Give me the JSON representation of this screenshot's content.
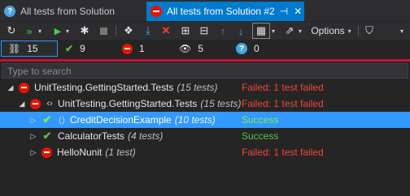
{
  "tabs": [
    {
      "label": "All tests from Solution",
      "icon": "question-icon",
      "active": false
    },
    {
      "label": "All tests from Solution #2",
      "icon": "failed-icon",
      "active": true,
      "pin_icon": "pin-icon",
      "close_icon": "close-icon"
    }
  ],
  "toolbar": {
    "options_label": "Options",
    "buttons": [
      "refresh-icon",
      "run-all-icon",
      "run-dropdown-icon",
      "run-icon",
      "run-dropdown-icon",
      "debug-icon",
      "stop-icon",
      "paw-icon",
      "import-icon",
      "remove-icon",
      "expand-all-icon",
      "collapse-all-icon",
      "up-icon",
      "down-icon",
      "calendar-icon",
      "export-icon",
      "options-dropdown-icon",
      "filter-icon"
    ]
  },
  "stats": {
    "total": "15",
    "passed": "9",
    "failed": "1",
    "ignored": "5",
    "inconclusive": "0"
  },
  "search": {
    "placeholder": "Type to search",
    "value": ""
  },
  "tree": [
    {
      "level": 0,
      "expanded": true,
      "status": "failed",
      "type_icon": "",
      "name": "UnitTesting.GettingStarted.Tests",
      "count": "(15 tests)",
      "result": "Failed: 1 test failed",
      "selected": false
    },
    {
      "level": 1,
      "expanded": true,
      "status": "failed",
      "type_icon": "namespace-icon",
      "name": "UnitTesting.GettingStarted.Tests",
      "count": "(15 tests)",
      "result": "Failed: 1 test failed",
      "selected": false
    },
    {
      "level": 2,
      "expanded": false,
      "status": "passed",
      "type_icon": "class-icon",
      "name": "CreditDecisionExample",
      "count": "(10 tests)",
      "result": "Success",
      "selected": true
    },
    {
      "level": 2,
      "expanded": false,
      "status": "passed",
      "type_icon": "",
      "name": "CalculatorTests",
      "count": "(4 tests)",
      "result": "Success",
      "selected": false
    },
    {
      "level": 2,
      "expanded": false,
      "status": "failed",
      "type_icon": "",
      "name": "HelloNunit",
      "count": "(1 test)",
      "result": "Failed: 1 test failed",
      "selected": false
    }
  ],
  "colors": {
    "accent": "#007acc",
    "selection": "#3399ff",
    "fail": "#e51400",
    "success": "#5fbf3a"
  }
}
